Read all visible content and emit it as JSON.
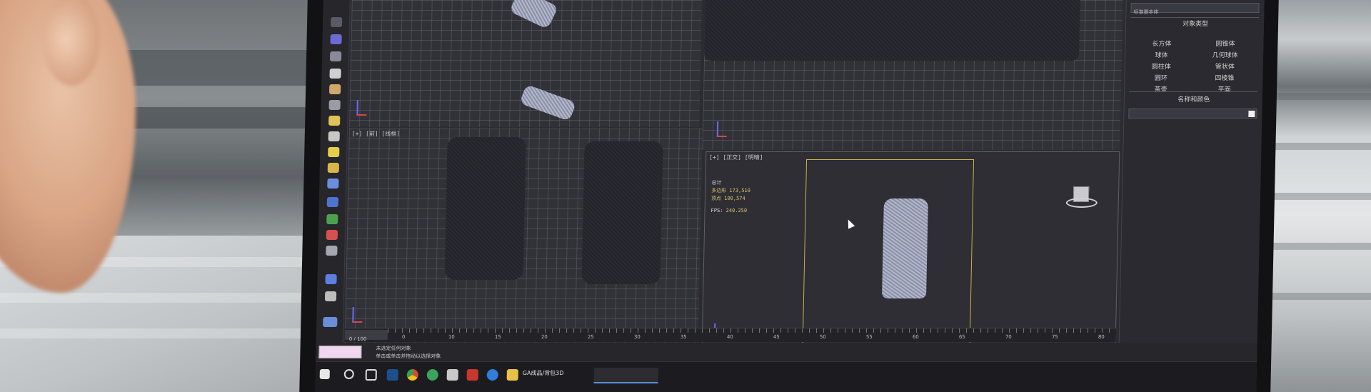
{
  "toolbar": {
    "icons": [
      "move-icon",
      "rotate-icon",
      "scale-icon",
      "select-icon",
      "link-icon",
      "camera-icon",
      "light-icon",
      "helper-icon",
      "shape-icon",
      "geometry-icon",
      "material-icon",
      "render-icon",
      "sphere-icon",
      "box-icon",
      "snap-icon",
      "layer-icon",
      "settings-icon",
      "help-icon"
    ]
  },
  "viewports": {
    "bottom_left_label": "[+] [前] [线框]",
    "bottom_right_label": "[+] [正交] [明暗]",
    "stats": {
      "row1_label": "总计",
      "row2_label": "多边形",
      "row2_value": "173,510",
      "row3_label": "顶点",
      "row3_value": "100,574",
      "fps_label": "FPS:",
      "fps_value": "240.250"
    }
  },
  "panel": {
    "search_placeholder": "标准基本体",
    "object_type_title": "对象类型",
    "object_types": [
      "长方体",
      "圆锥体",
      "球体",
      "几何球体",
      "圆柱体",
      "管状体",
      "圆环",
      "四棱锥",
      "茶壶",
      "平面"
    ],
    "name_color_title": "名称和颜色"
  },
  "timeline": {
    "frame_counter": "0 / 100",
    "ticks": [
      "0",
      "10",
      "15",
      "20",
      "25",
      "30",
      "35",
      "40",
      "45",
      "50",
      "55",
      "60",
      "65",
      "70",
      "75",
      "80"
    ]
  },
  "status": {
    "line1": "未选定任何对象",
    "line2": "单击或单击并拖动以选择对象"
  },
  "taskbar": {
    "icons": [
      "windows-icon",
      "search-icon",
      "taskview-icon",
      "photoshop-icon",
      "chrome-icon",
      "browser-icon",
      "app-icon",
      "acrobat-icon",
      "media-icon",
      "folder-icon"
    ],
    "app_title": "GA成品/背包3D"
  },
  "colors": {
    "viewport_bg": "#313138",
    "active_frame": "#c8b24a",
    "stats_text": "#d8c46a"
  }
}
